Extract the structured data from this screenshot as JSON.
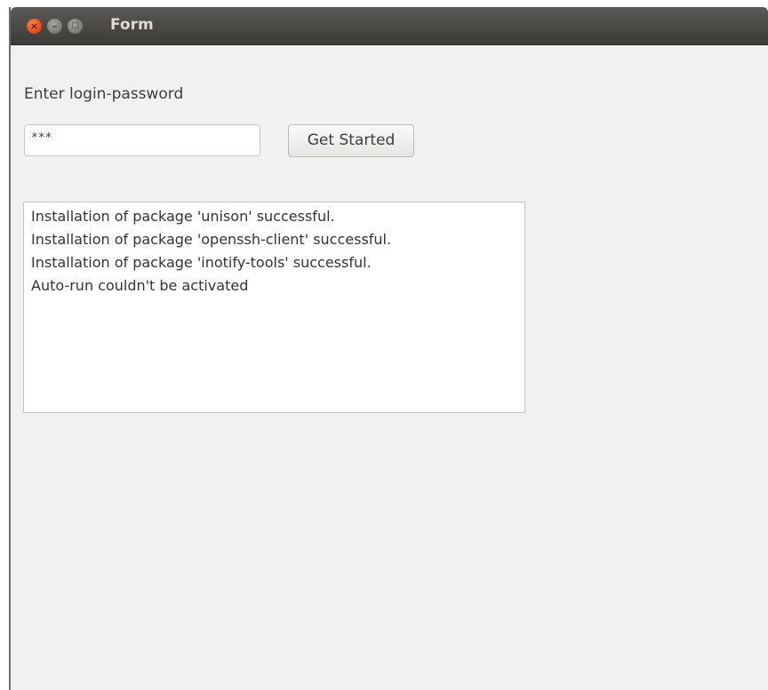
{
  "window": {
    "title": "Form",
    "controls": {
      "close": "×",
      "minimize": "–",
      "maximize": "□"
    }
  },
  "form": {
    "prompt_label": "Enter login-password",
    "password_value": "***",
    "submit_label": "Get Started"
  },
  "log": {
    "lines": [
      "Installation of package 'unison' successful.",
      "Installation of package 'openssh-client' successful.",
      "Installation of package 'inotify-tools' successful.",
      "Auto-run couldn't be activated"
    ]
  }
}
